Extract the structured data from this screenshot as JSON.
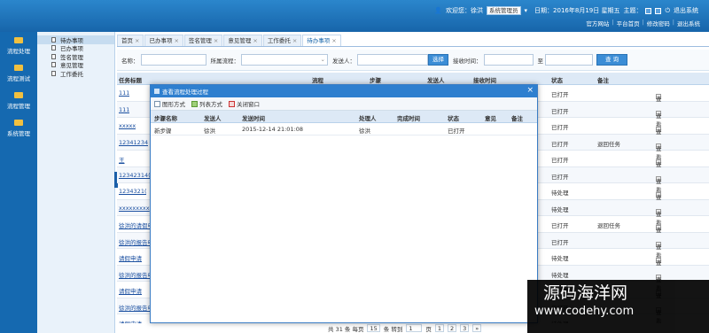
{
  "header": {
    "welcome": "欢迎您：徐洪",
    "role_select": "系统管理员",
    "date": "日期：2016年8月19日 星期五",
    "theme_label": "主题：",
    "logout": "退出系统",
    "links": [
      "官方网站",
      "平台首页",
      "修改密码",
      "退出系统"
    ]
  },
  "left_nav": [
    {
      "label": "流程处理"
    },
    {
      "label": "流程测试"
    },
    {
      "label": "流程管理"
    },
    {
      "label": "系统管理"
    }
  ],
  "sub_nav": [
    {
      "label": "待办事项"
    },
    {
      "label": "已办事项"
    },
    {
      "label": "签名管理"
    },
    {
      "label": "意见管理"
    },
    {
      "label": "工作委托"
    }
  ],
  "tabs": [
    {
      "label": "首页"
    },
    {
      "label": "已办事项"
    },
    {
      "label": "签名管理"
    },
    {
      "label": "意见管理"
    },
    {
      "label": "工作委托"
    },
    {
      "label": "待办事项"
    }
  ],
  "search": {
    "name_label": "名称：",
    "flow_label": "所属流程：",
    "sender_label": "发送人：",
    "select_btn": "选择",
    "recv_label": "接收时间：",
    "to_label": "至",
    "query_btn": "查 询"
  },
  "grid": {
    "headers": [
      "任务标题",
      "流程",
      "步骤",
      "发送人",
      "接收时间",
      "状态",
      "备注"
    ],
    "rows": [
      {
        "title": "111",
        "status": "已打开",
        "note": "",
        "action": "查看"
      },
      {
        "title": "111",
        "status": "已打开",
        "note": "",
        "action": "查看"
      },
      {
        "title": "xxxxx",
        "status": "已打开",
        "note": "",
        "action": "查看"
      },
      {
        "title": "12341234",
        "status": "已打开",
        "note": "退回任务",
        "action": "查看"
      },
      {
        "title": "王",
        "status": "已打开",
        "note": "",
        "action": "查看"
      },
      {
        "title": "12342314(",
        "status": "已打开",
        "note": "",
        "action": "查看"
      },
      {
        "title": "1234321(",
        "status": "待处理",
        "note": "",
        "action": "查看"
      },
      {
        "title": "xxxxxxxxx",
        "status": "待处理",
        "note": "",
        "action": "查看"
      },
      {
        "title": "徐洪的请假申",
        "status": "已打开",
        "note": "退回任务",
        "action": "查看"
      },
      {
        "title": "徐洪的报告申",
        "status": "已打开",
        "note": "",
        "action": "查看"
      },
      {
        "title": "请假申请",
        "status": "待处理",
        "note": "",
        "action": "查看"
      },
      {
        "title": "徐洪的报告申",
        "status": "待处理",
        "note": "",
        "action": "查看"
      },
      {
        "title": "请假申请",
        "status": "已打开",
        "note": "",
        "action": "查看"
      },
      {
        "title": "徐洪的报告申",
        "status": "已打开",
        "note": "",
        "action": "查看"
      },
      {
        "title": "请假申请",
        "status": "待处理",
        "note": "",
        "action": "查看"
      }
    ]
  },
  "pager": {
    "summary": "共 31 条 每页",
    "per_page": "15",
    "goto": "条 转到",
    "page_input": "1",
    "page_unit": "页",
    "pages": [
      "1",
      "2",
      "3",
      "»"
    ]
  },
  "dialog": {
    "title": "查看流程处理过程",
    "tools": [
      "图形方式",
      "列表方式",
      "关闭窗口"
    ],
    "headers": [
      "步骤名称",
      "发送人",
      "发送时间",
      "处理人",
      "完成时间",
      "状态",
      "意见",
      "备注"
    ],
    "rows": [
      {
        "step": "新步骤",
        "sender": "徐洪",
        "send_time": "2015-12-14 21:01:08",
        "handler": "徐洪",
        "done_time": "",
        "status": "已打开",
        "opinion": "",
        "note": ""
      }
    ]
  },
  "watermark": {
    "line1": "源码海洋网",
    "line2": "www.codehy.com"
  },
  "colors": {
    "brand": "#1a6fb5",
    "dialog_title": "#2e7fcf"
  }
}
